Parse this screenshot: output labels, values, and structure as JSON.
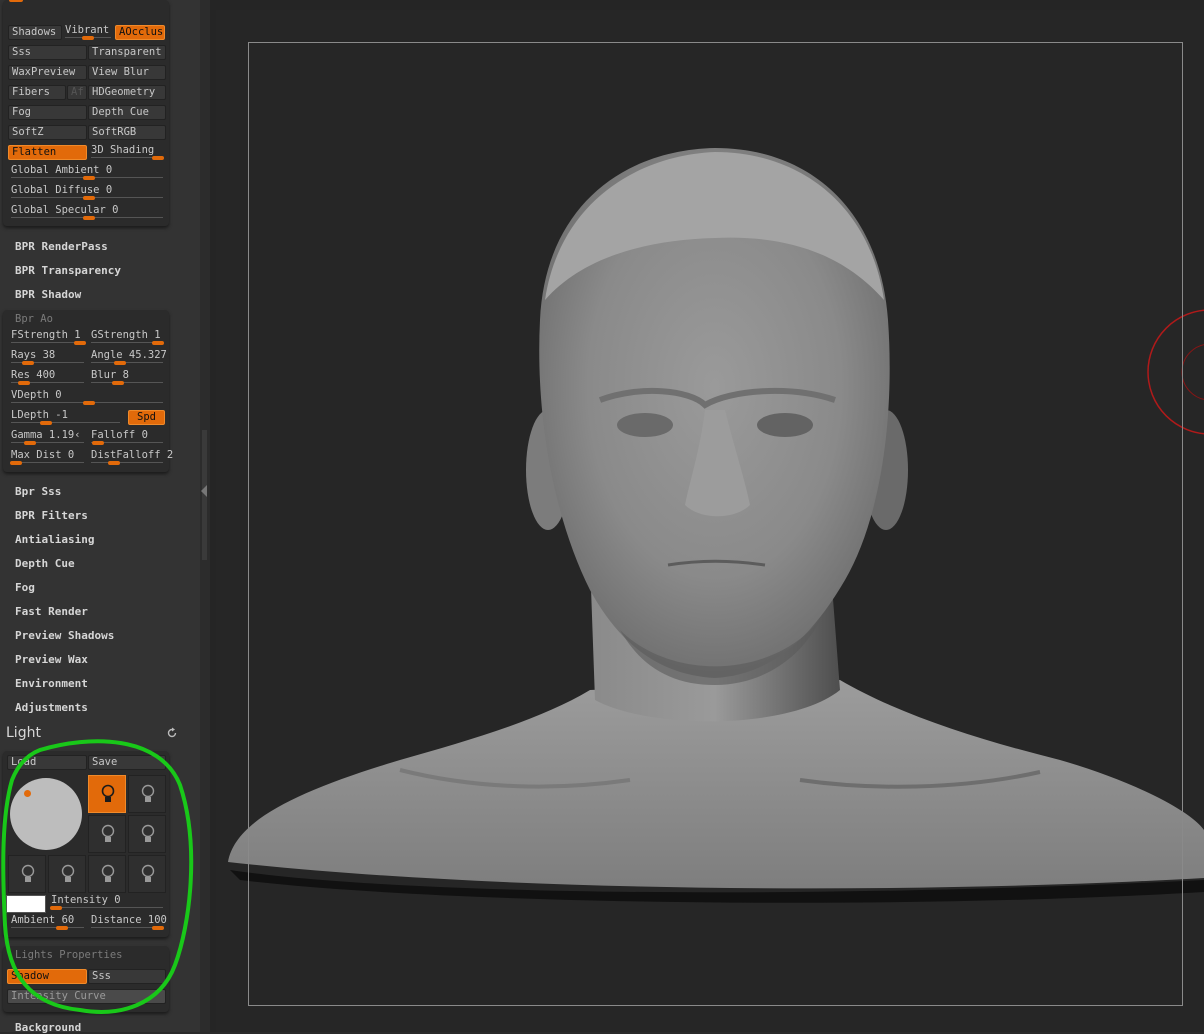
{
  "render_toggles": {
    "shadows": "Shadows",
    "vibrant": "Vibrant",
    "aocclusion": "AOcclusi",
    "sss": "Sss",
    "transparent": "Transparent",
    "waxpreview": "WaxPreview",
    "view_blur": "View Blur",
    "fibers": "Fibers",
    "af": "Af",
    "hdgeometry": "HDGeometry",
    "fog": "Fog",
    "depth_cue": "Depth Cue",
    "softz": "SoftZ",
    "softrgb": "SoftRGB",
    "flatten": "Flatten",
    "shading_3d": "3D Shading",
    "global_ambient": "Global Ambient 0",
    "global_diffuse": "Global Diffuse 0",
    "global_specular": "Global Specular 0"
  },
  "bpr_menu_top": [
    "BPR RenderPass",
    "BPR Transparency",
    "BPR Shadow"
  ],
  "bpr_ao": {
    "title": "Bpr Ao",
    "fstrength": "FStrength 1",
    "gstrength": "GStrength 1",
    "rays": "Rays 38",
    "angle": "Angle 45.327",
    "res": "Res 400",
    "blur": "Blur 8",
    "vdepth": "VDepth 0",
    "ldepth": "LDepth -1",
    "spd": "Spd",
    "gamma": "Gamma 1.19‹",
    "falloff": "Falloff 0",
    "max_dist": "Max Dist 0",
    "dist_falloff": "DistFalloff 2"
  },
  "render_menu": [
    "Bpr Sss",
    "BPR Filters",
    "Antialiasing",
    "Depth Cue",
    "Fog",
    "Fast Render",
    "Preview Shadows",
    "Preview Wax",
    "Environment",
    "Adjustments"
  ],
  "light": {
    "title": "Light",
    "load": "Load",
    "save": "Save",
    "intensity": "Intensity 0",
    "ambient": "Ambient 60",
    "distance": "Distance 100",
    "swatch_color": "#ffffff",
    "lights_properties_title": "Lights Properties",
    "shadow": "Shadow",
    "sss": "Sss",
    "intensity_curve": "Intensity Curve"
  },
  "background_item": "Background",
  "colors": {
    "accent": "#e26a0a",
    "highlight_marker": "#19c819",
    "panel_bg": "#333333"
  },
  "icons": {
    "refresh": "refresh-icon",
    "bulb": "lightbulb-icon"
  }
}
